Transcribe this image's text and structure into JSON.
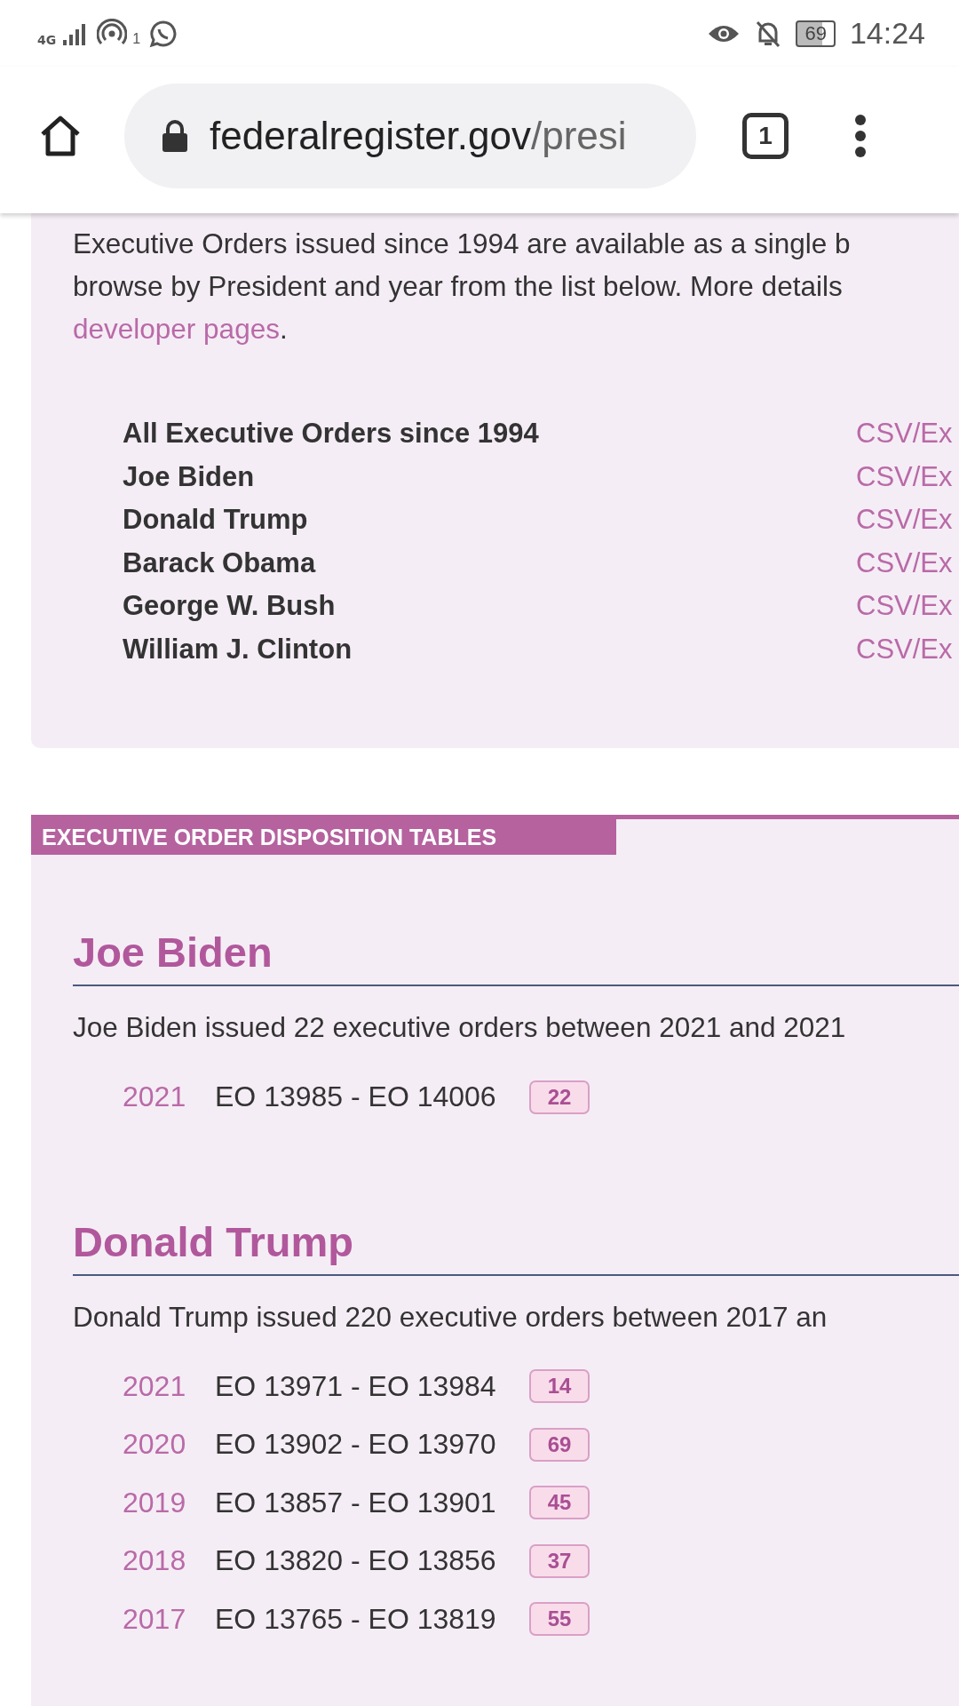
{
  "status_bar": {
    "network": "4G",
    "hotspot_count": "1",
    "battery": "69",
    "time": "14:24"
  },
  "browser": {
    "url_host": "federalregister.gov",
    "url_path": "/presi",
    "tab_count": "1"
  },
  "intro": {
    "lines": [
      "Executive Orders issued since 1994 are available as a single b",
      "browse by President and year from the list below. More details"
    ],
    "link": "developer pages",
    "tail": "."
  },
  "downloads": [
    {
      "name": "All Executive Orders since 1994",
      "link": "CSV/Ex"
    },
    {
      "name": "Joe Biden",
      "link": "CSV/Ex"
    },
    {
      "name": "Donald Trump",
      "link": "CSV/Ex"
    },
    {
      "name": "Barack Obama",
      "link": "CSV/Ex"
    },
    {
      "name": "George W. Bush",
      "link": "CSV/Ex"
    },
    {
      "name": "William J. Clinton",
      "link": "CSV/Ex"
    }
  ],
  "section_title": "EXECUTIVE ORDER DISPOSITION TABLES",
  "presidents": [
    {
      "name": "Joe Biden",
      "summary": "Joe Biden issued 22 executive orders between 2021 and 2021",
      "years": [
        {
          "year": "2021",
          "range": "EO 13985 - EO 14006",
          "count": "22"
        }
      ]
    },
    {
      "name": "Donald Trump",
      "summary": "Donald Trump issued 220 executive orders between 2017 an",
      "years": [
        {
          "year": "2021",
          "range": "EO 13971 - EO 13984",
          "count": "14"
        },
        {
          "year": "2020",
          "range": "EO 13902 - EO 13970",
          "count": "69"
        },
        {
          "year": "2019",
          "range": "EO 13857 - EO 13901",
          "count": "45"
        },
        {
          "year": "2018",
          "range": "EO 13820 - EO 13856",
          "count": "37"
        },
        {
          "year": "2017",
          "range": "EO 13765 - EO 13819",
          "count": "55"
        }
      ]
    }
  ]
}
